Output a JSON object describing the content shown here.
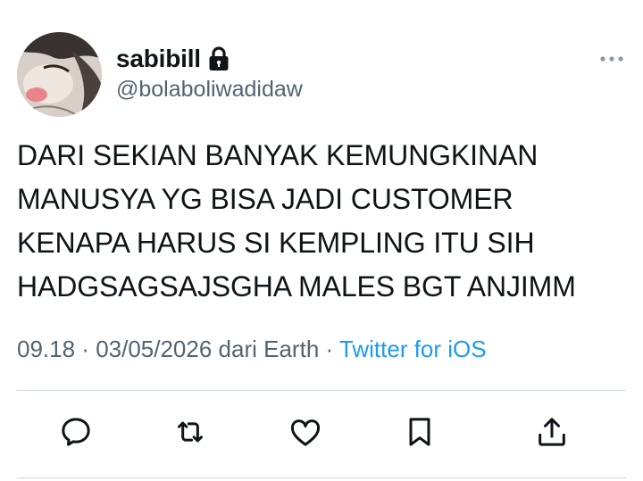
{
  "user": {
    "display_name": "sabibill",
    "handle": "@bolaboliwadidaw",
    "avatar_icon": "avatar-photo",
    "protected_icon": "lock-icon"
  },
  "tweet": {
    "lines": [
      "DARI SEKIAN BANYAK KEMUNGKINAN",
      "MANUSYA YG BISA JADI CUSTOMER",
      "KENAPA HARUS SI KEMPLING ITU SIH",
      "HADGSAGSAJSGHA MALES BGT ANJIMM"
    ]
  },
  "meta": {
    "time": "09.18",
    "separator1": " · ",
    "date": "03/05/2026",
    "location": " dari Earth",
    "separator2": " · ",
    "source": "Twitter for iOS"
  },
  "actions": [
    {
      "name": "reply",
      "icon": "reply-icon"
    },
    {
      "name": "retweet",
      "icon": "retweet-icon"
    },
    {
      "name": "like",
      "icon": "heart-icon"
    },
    {
      "name": "bookmark",
      "icon": "bookmark-icon"
    },
    {
      "name": "share",
      "icon": "share-icon"
    }
  ],
  "colors": {
    "text": "#0f1419",
    "secondary": "#536471",
    "link": "#1d9bf0",
    "divider": "#cfd9de"
  }
}
